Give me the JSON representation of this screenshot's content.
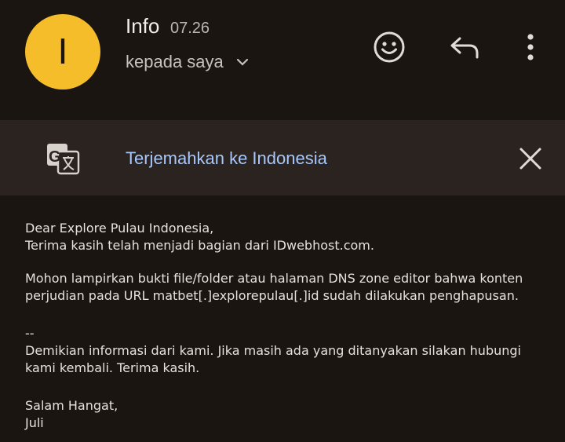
{
  "header": {
    "avatar_letter": "I",
    "sender": "Info",
    "time": "07.26",
    "recipient": "kepada saya",
    "icons": {
      "recipient_toggle": "chevron-down-icon",
      "emoji": "emoji-reaction-icon",
      "reply": "reply-icon",
      "more": "more-vertical-icon"
    }
  },
  "translate": {
    "label": "Terjemahkan ke Indonesia",
    "icon": "google-translate-icon",
    "close_icon": "close-icon"
  },
  "message": {
    "lines_block1": [
      "Dear Explore Pulau Indonesia,",
      "Terima kasih telah menjadi bagian dari IDwebhost.com."
    ],
    "lines_block2": [
      "Mohon lampirkan bukti file/folder atau halaman DNS zone editor bahwa konten",
      "perjudian pada URL matbet[.]explorepulau[.]id sudah dilakukan penghapusan."
    ],
    "signature_sep": "--",
    "lines_block3": [
      "Demikian informasi dari kami. Jika masih ada yang ditanyakan silakan hubungi",
      "kami kembali. Terima kasih."
    ],
    "lines_block4": [
      "Salam Hangat,",
      "Juli"
    ]
  },
  "colors": {
    "background": "#1b1512",
    "translate_bar": "#2a2320",
    "avatar": "#f6bd2b",
    "link": "#a8c7fa"
  }
}
